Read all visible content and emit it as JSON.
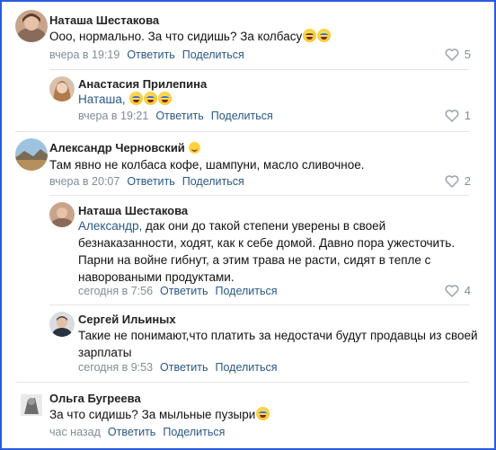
{
  "comments": [
    {
      "author": "Наташа Шестакова",
      "text": "Ооо, нормально. За что сидишь? За колбасу",
      "time": "вчера в 19:19",
      "reply": "Ответить",
      "share": "Поделиться",
      "likes": "5",
      "replies": [
        {
          "author": "Анастасия Прилепина",
          "mention": "Наташа,",
          "text": "",
          "time": "вчера в 19:21",
          "reply": "Ответить",
          "share": "Поделиться",
          "likes": "1"
        }
      ]
    },
    {
      "author": "Александр Черновский",
      "text": "Там явно не колбаса кофе, шампуни, масло сливочное.",
      "time": "вчера в 20:07",
      "reply": "Ответить",
      "share": "Поделиться",
      "likes": "2",
      "replies": [
        {
          "author": "Наташа Шестакова",
          "mention": "Александр,",
          "text_line1": " дак они до такой степени уверены в своей",
          "text_line2": "безнаказанности, ходят, как к себе домой. Давно пора ужесточить.",
          "text_line3": "Парни на войне гибнут, а этим трава не расти, сидят в тепле с",
          "text_line4": "навороваными продуктами.",
          "time": "сегодня в 7:56",
          "reply": "Ответить",
          "share": "Поделиться",
          "likes": "4"
        },
        {
          "author": "Сергей Ильиных",
          "text_line1": "Такие не понимают,что платить за недостачи будут продавцы из своей",
          "text_line2": "зарплаты",
          "time": "сегодня в 9:53",
          "reply": "Ответить",
          "share": "Поделиться"
        }
      ]
    },
    {
      "author": "Ольга Бугреева",
      "text": "За что сидишь? За мыльные пузыри",
      "time": "час назад",
      "reply": "Ответить",
      "share": "Поделиться"
    }
  ],
  "colors": {
    "link": "#2a5885",
    "meta": "#818c99",
    "frame": "#2a5ce0"
  },
  "icons": {
    "like": "heart-outline-icon",
    "emoji": "laughing-emoji-icon"
  }
}
